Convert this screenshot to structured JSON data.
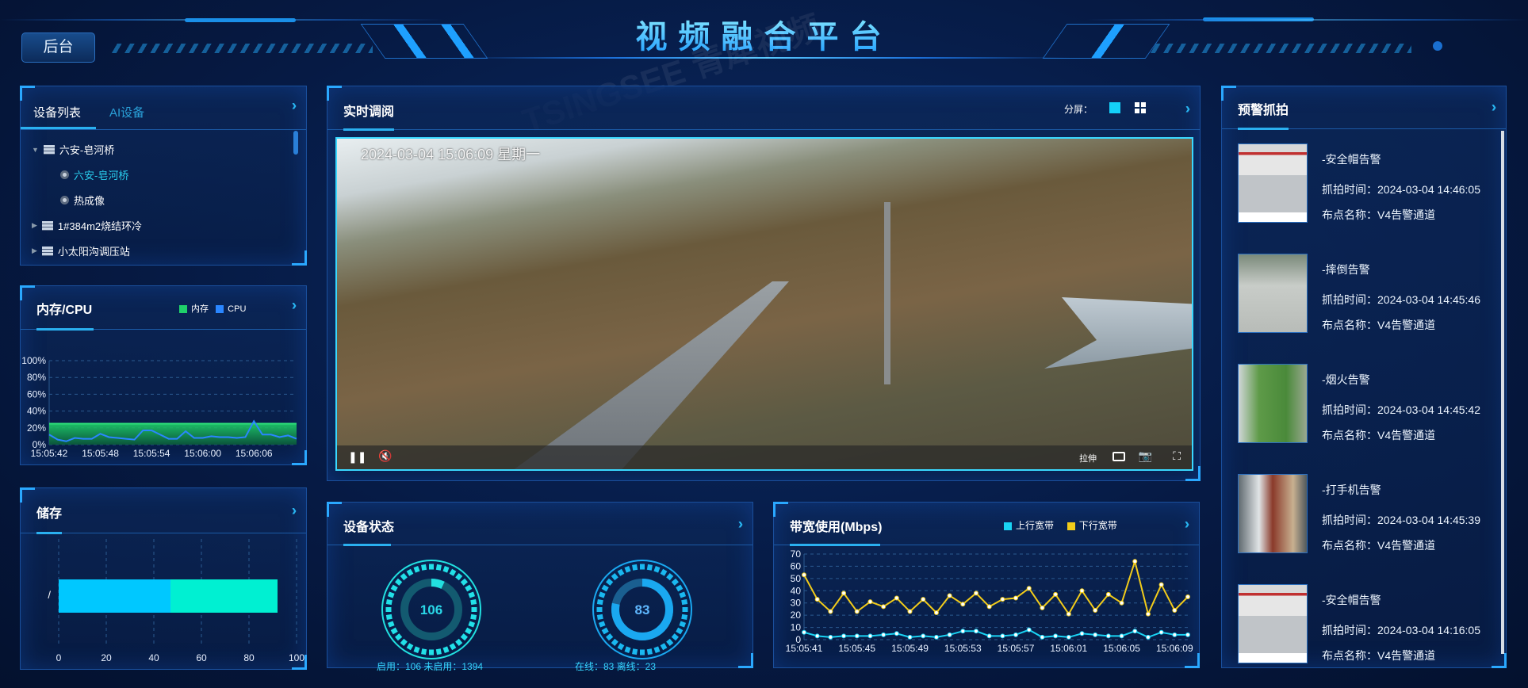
{
  "header": {
    "title": "视频融合平台",
    "back_button": "后台"
  },
  "watermark": "TSINGSEE 青犀视频",
  "device_panel": {
    "tabs": [
      {
        "label": "设备列表",
        "active": true
      },
      {
        "label": "AI设备",
        "active": false
      }
    ],
    "tree": [
      {
        "label": "六安-皂河桥",
        "type": "server",
        "expanded": true,
        "children": [
          {
            "label": "六安-皂河桥",
            "type": "camera",
            "selected": true
          },
          {
            "label": "热成像",
            "type": "camera"
          }
        ]
      },
      {
        "label": "1#384m2烧结环冷",
        "type": "server",
        "expanded": false
      },
      {
        "label": "小太阳沟调压站",
        "type": "server",
        "expanded": false
      }
    ]
  },
  "cpu_panel": {
    "title": "内存/CPU",
    "legend": [
      "内存",
      "CPU"
    ]
  },
  "storage_panel": {
    "title": "储存"
  },
  "video_panel": {
    "title": "实时调阅",
    "split_label": "分屏：",
    "osd_time": "2024-03-04 15:06:09 星期一",
    "stretch_label": "拉伸",
    "icons": [
      "pause-icon",
      "mute-icon",
      "record-icon",
      "snapshot-icon",
      "fullscreen-icon"
    ]
  },
  "status_panel": {
    "title": "设备状态",
    "gauges": [
      {
        "value": "106",
        "fraction": 0.0707,
        "caption": "启用：106 未启用：1394",
        "color": "#22e0e0"
      },
      {
        "value": "83",
        "fraction": 0.783,
        "caption": "在线：83 离线：23",
        "color": "#1aa8f0"
      }
    ]
  },
  "bandwidth_panel": {
    "title": "带宽使用(Mbps)",
    "legend": [
      "上行宽带",
      "下行宽带"
    ]
  },
  "alerts_panel": {
    "title": "预警抓拍",
    "items": [
      {
        "type": "-安全帽告警",
        "time": "抓拍时间：2024-03-04 14:46:05",
        "point": "布点名称：V4告警通道"
      },
      {
        "type": "-摔倒告警",
        "time": "抓拍时间：2024-03-04 14:45:46",
        "point": "布点名称：V4告警通道"
      },
      {
        "type": "-烟火告警",
        "time": "抓拍时间：2024-03-04 14:45:42",
        "point": "布点名称：V4告警通道"
      },
      {
        "type": "-打手机告警",
        "time": "抓拍时间：2024-03-04 14:45:39",
        "point": "布点名称：V4告警通道"
      },
      {
        "type": "-安全帽告警",
        "time": "抓拍时间：2024-03-04 14:16:05",
        "point": "布点名称：V4告警通道"
      }
    ]
  },
  "colors": {
    "accent": "#2ab0f0",
    "memory": "#1fd06a",
    "cpu": "#2a86ff",
    "uplink": "#19d3f3",
    "downlink": "#f2cc1a",
    "storage_used": "#00c8ff",
    "storage_free": "#00f0d2"
  },
  "chart_data": [
    {
      "type": "area",
      "name": "内存/CPU",
      "yticks": [
        "0%",
        "20%",
        "40%",
        "60%",
        "80%",
        "100%"
      ],
      "ylim": [
        0,
        100
      ],
      "xticks": [
        "15:05:42",
        "15:05:48",
        "15:05:54",
        "15:06:00",
        "15:06:06"
      ],
      "series": [
        {
          "name": "内存",
          "values": [
            25,
            25,
            25,
            25,
            25,
            25,
            25,
            25,
            25,
            25,
            25,
            25,
            25,
            25,
            25,
            25,
            25,
            25,
            25,
            25,
            25,
            25,
            25,
            25,
            25,
            25,
            25,
            25,
            25,
            25
          ]
        },
        {
          "name": "CPU",
          "values": [
            12,
            6,
            4,
            8,
            7,
            7,
            13,
            9,
            8,
            7,
            6,
            17,
            17,
            12,
            7,
            7,
            16,
            8,
            8,
            10,
            9,
            9,
            8,
            9,
            28,
            12,
            12,
            9,
            11,
            7
          ]
        }
      ],
      "grid": true
    },
    {
      "type": "bar",
      "orientation": "horizontal",
      "stacked": true,
      "name": "储存",
      "categories": [
        "/"
      ],
      "series": [
        {
          "values": [
            47
          ]
        },
        {
          "values": [
            45
          ]
        }
      ],
      "xticks": [
        "0",
        "20",
        "40",
        "60",
        "80",
        "100"
      ],
      "xlim": [
        0,
        100
      ]
    },
    {
      "type": "line",
      "name": "带宽使用(Mbps)",
      "ylim": [
        0,
        70
      ],
      "yticks": [
        "0",
        "10",
        "20",
        "30",
        "40",
        "50",
        "60",
        "70"
      ],
      "xticks": [
        "15:05:41",
        "15:05:45",
        "15:05:49",
        "15:05:53",
        "15:05:57",
        "15:06:01",
        "15:06:05",
        "15:06:09"
      ],
      "series": [
        {
          "name": "上行宽带",
          "values": [
            6,
            3,
            2,
            3,
            3,
            3,
            4,
            5,
            2,
            3,
            2,
            4,
            7,
            7,
            3,
            3,
            4,
            8,
            2,
            3,
            2,
            5,
            4,
            3,
            3,
            7,
            2,
            6,
            4,
            4
          ]
        },
        {
          "name": "下行宽带",
          "values": [
            53,
            33,
            23,
            38,
            23,
            31,
            27,
            34,
            23,
            33,
            22,
            36,
            29,
            38,
            27,
            33,
            34,
            42,
            26,
            37,
            21,
            40,
            24,
            37,
            30,
            64,
            21,
            45,
            24,
            35
          ]
        }
      ],
      "grid": true
    }
  ]
}
